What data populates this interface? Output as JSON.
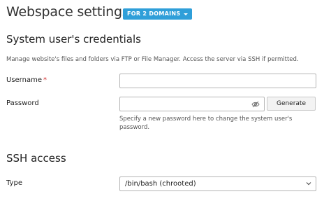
{
  "header": {
    "title": "Webspace settings",
    "domains_badge": "FOR 2 DOMAINS",
    "badge_color": "#2f9fd9"
  },
  "credentials": {
    "section_title": "System user's credentials",
    "description": "Manage website's files and folders via FTP or File Manager. Access the server via SSH if permitted.",
    "username_label": "Username",
    "username_required_mark": "*",
    "username_value": "",
    "password_label": "Password",
    "password_value": "",
    "generate_label": "Generate",
    "password_hint": "Specify a new password here to change the system user's password.",
    "show_password_icon": "eye-slash-icon"
  },
  "ssh": {
    "section_title": "SSH access",
    "type_label": "Type",
    "type_selected": "/bin/bash (chrooted)"
  }
}
